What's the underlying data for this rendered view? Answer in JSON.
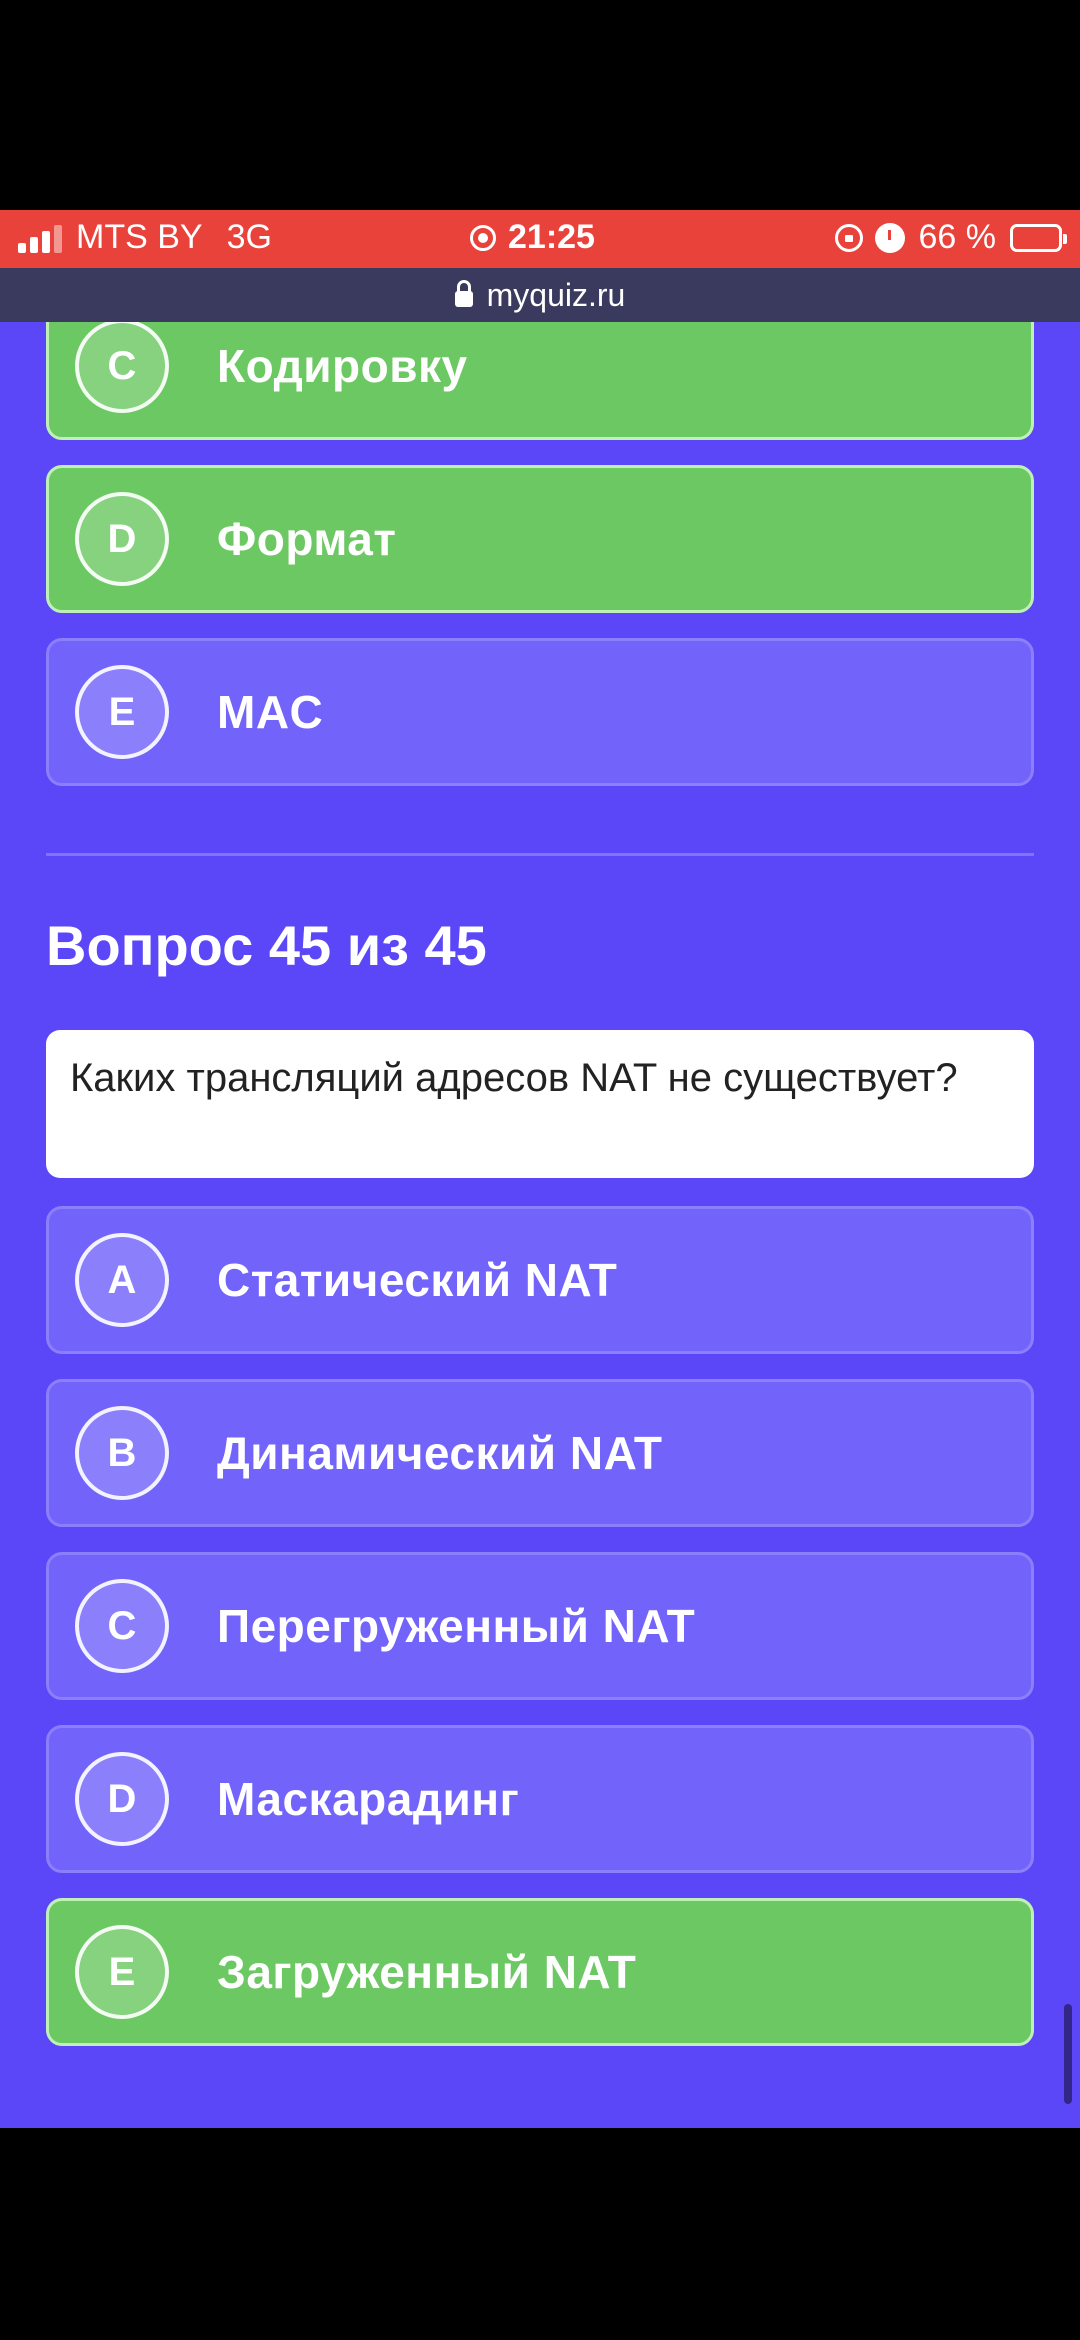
{
  "status_bar": {
    "carrier": "MTS BY",
    "network": "3G",
    "time": "21:25",
    "battery_percent": "66 %",
    "battery_level": 0.66
  },
  "browser": {
    "url": "myquiz.ru"
  },
  "previous_question": {
    "options": [
      {
        "letter": "C",
        "text": "Кодировку",
        "state": "correct"
      },
      {
        "letter": "D",
        "text": "Формат",
        "state": "correct"
      },
      {
        "letter": "E",
        "text": "MAC",
        "state": "default"
      }
    ]
  },
  "question": {
    "heading": "Вопрос 45 из 45",
    "text": "Каких трансляций адресов NAT не существует?",
    "options": [
      {
        "letter": "A",
        "text": "Статический NAT",
        "state": "default"
      },
      {
        "letter": "B",
        "text": "Динамический NAT",
        "state": "default"
      },
      {
        "letter": "C",
        "text": "Перегруженный NAT",
        "state": "default"
      },
      {
        "letter": "D",
        "text": "Маскарадинг",
        "state": "default"
      },
      {
        "letter": "E",
        "text": "Загруженный NAT",
        "state": "correct"
      }
    ]
  },
  "colors": {
    "background": "#5b47f7",
    "option_default": "#7263fa",
    "option_correct": "#6cc863",
    "status_bar": "#e9423a"
  }
}
